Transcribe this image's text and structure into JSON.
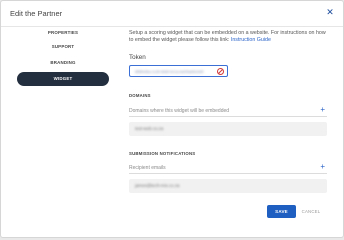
{
  "header": {
    "title": "Edit the Partner",
    "close_glyph": "✕"
  },
  "nav": {
    "items": [
      {
        "label": "PROPERTIES"
      },
      {
        "label": "SUPPORT"
      },
      {
        "label": "BRANDING"
      },
      {
        "label": "WIDGET"
      }
    ],
    "active": "WIDGET"
  },
  "widget": {
    "intro_text": "Setup a scoring widget that can be embedded on a website. For instructions on how to embed the widget please follow this link:",
    "intro_link": "Instruction Guide",
    "token_label": "Token",
    "token_value": "8f5f0d5a-1c3f-4b6f-9c1a-fa2f4a0b2d4f",
    "token_icon": "no-entry-icon"
  },
  "domains": {
    "section_title": "DOMAINS",
    "field_placeholder": "Domains where this widget will be embedded",
    "add_glyph": "+",
    "entries": [
      "test-web.co.za"
    ]
  },
  "notifications": {
    "section_title": "SUBMISSION NOTIFICATIONS",
    "field_placeholder": "Recipient emails",
    "add_glyph": "+",
    "entries": [
      "james@tech-mix.co.za"
    ]
  },
  "actions": {
    "save_label": "SAVE",
    "cancel_label": "CANCEL"
  },
  "colors": {
    "primary": "#1f5fc2",
    "nav_active": "#232e3e",
    "link": "#2a63c8",
    "danger": "#d33a3a"
  }
}
